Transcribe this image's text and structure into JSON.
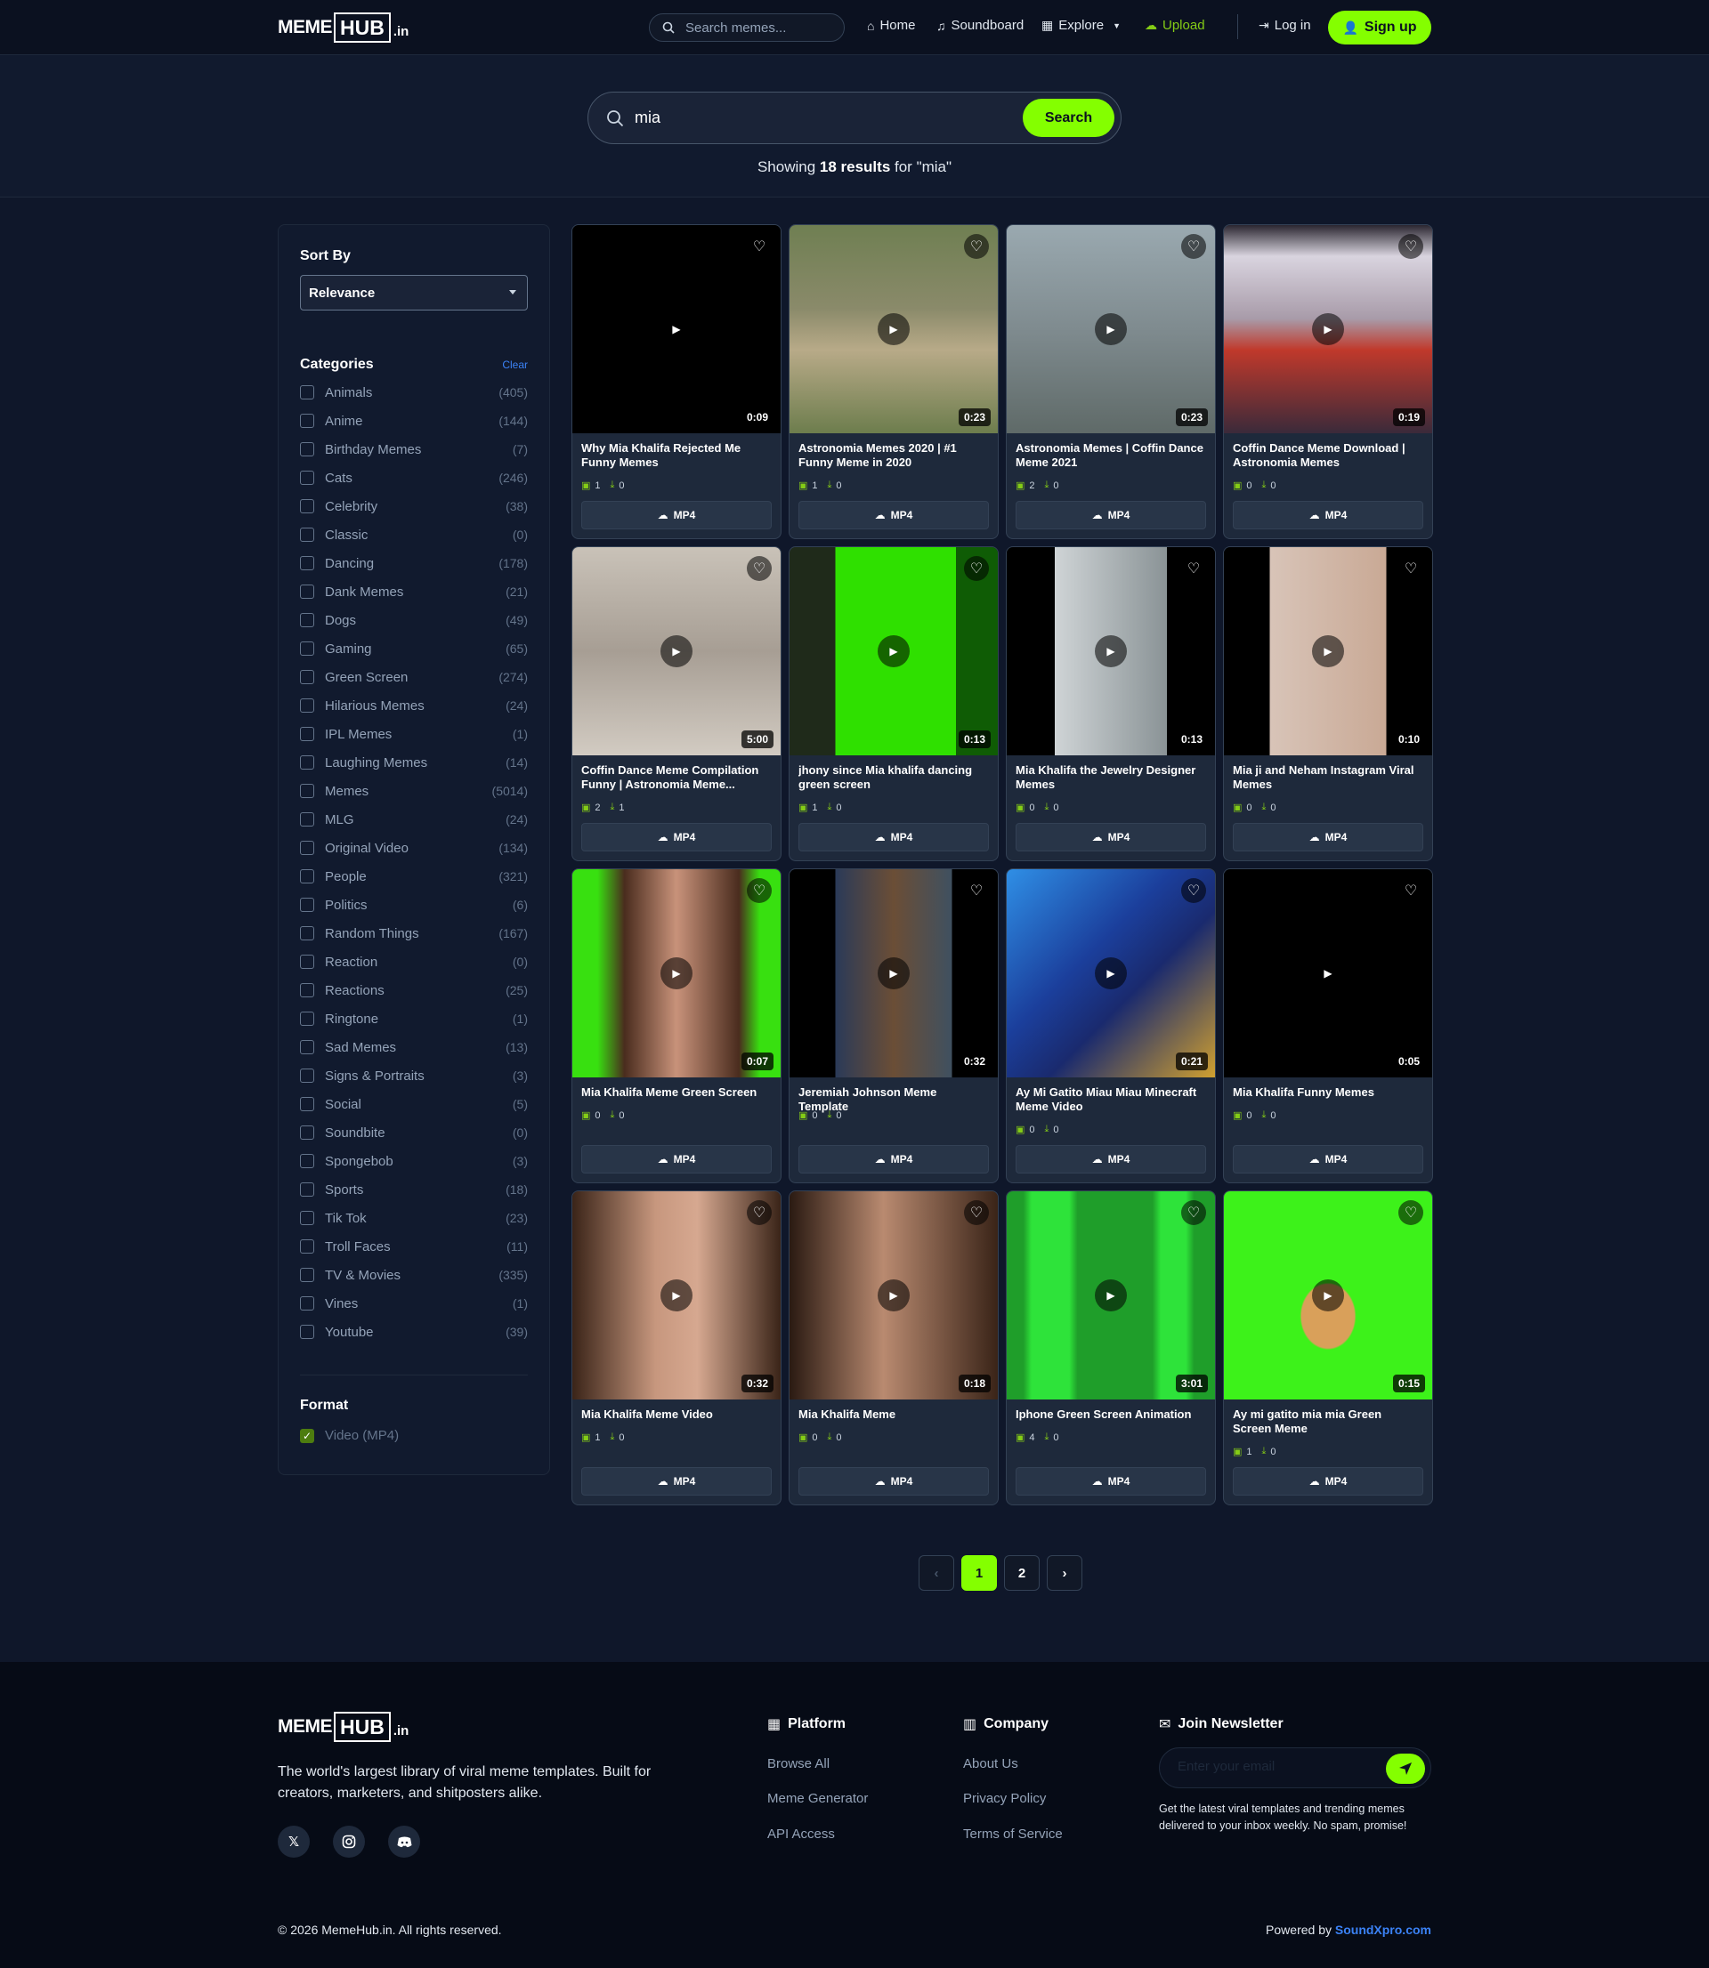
{
  "brand": {
    "meme": "MEME",
    "hub": "HUB",
    "tld": ".in"
  },
  "nav": {
    "search_placeholder": "Search memes...",
    "home": "Home",
    "soundboard": "Soundboard",
    "explore": "Explore",
    "upload": "Upload",
    "login": "Log in",
    "signup": "Sign up"
  },
  "hero": {
    "query": "mia",
    "search_button": "Search",
    "results_prefix": "Showing ",
    "results_count": "18 results",
    "results_suffix": " for \"mia\""
  },
  "sidebar": {
    "sort_title": "Sort By",
    "sort_value": "Relevance",
    "categories_title": "Categories",
    "clear": "Clear",
    "categories": [
      {
        "name": "Animals",
        "count": "(405)"
      },
      {
        "name": "Anime",
        "count": "(144)"
      },
      {
        "name": "Birthday Memes",
        "count": "(7)"
      },
      {
        "name": "Cats",
        "count": "(246)"
      },
      {
        "name": "Celebrity",
        "count": "(38)"
      },
      {
        "name": "Classic",
        "count": "(0)"
      },
      {
        "name": "Dancing",
        "count": "(178)"
      },
      {
        "name": "Dank Memes",
        "count": "(21)"
      },
      {
        "name": "Dogs",
        "count": "(49)"
      },
      {
        "name": "Gaming",
        "count": "(65)"
      },
      {
        "name": "Green Screen",
        "count": "(274)"
      },
      {
        "name": "Hilarious Memes",
        "count": "(24)"
      },
      {
        "name": "IPL Memes",
        "count": "(1)"
      },
      {
        "name": "Laughing Memes",
        "count": "(14)"
      },
      {
        "name": "Memes",
        "count": "(5014)"
      },
      {
        "name": "MLG",
        "count": "(24)"
      },
      {
        "name": "Original Video",
        "count": "(134)"
      },
      {
        "name": "People",
        "count": "(321)"
      },
      {
        "name": "Politics",
        "count": "(6)"
      },
      {
        "name": "Random Things",
        "count": "(167)"
      },
      {
        "name": "Reaction",
        "count": "(0)"
      },
      {
        "name": "Reactions",
        "count": "(25)"
      },
      {
        "name": "Ringtone",
        "count": "(1)"
      },
      {
        "name": "Sad Memes",
        "count": "(13)"
      },
      {
        "name": "Signs & Portraits",
        "count": "(3)"
      },
      {
        "name": "Social",
        "count": "(5)"
      },
      {
        "name": "Soundbite",
        "count": "(0)"
      },
      {
        "name": "Spongebob",
        "count": "(3)"
      },
      {
        "name": "Sports",
        "count": "(18)"
      },
      {
        "name": "Tik Tok",
        "count": "(23)"
      },
      {
        "name": "Troll Faces",
        "count": "(11)"
      },
      {
        "name": "TV & Movies",
        "count": "(335)"
      },
      {
        "name": "Vines",
        "count": "(1)"
      },
      {
        "name": "Youtube",
        "count": "(39)"
      }
    ],
    "format_title": "Format",
    "format_option": "Video (MP4)"
  },
  "cards": [
    {
      "title": "Why Mia Khalifa Rejected Me Funny Memes",
      "duration": "0:09",
      "a": "1",
      "b": "0",
      "bg": "#000000",
      "fav_dark": false
    },
    {
      "title": "Astronomia Memes 2020 | #1 Funny Meme in 2020",
      "duration": "0:23",
      "a": "1",
      "b": "0",
      "bg": "linear-gradient(180deg,#6f7f52 0%,#8a8a6a 40%,#b8aa88 60%,#6d7d4d 100%)",
      "fav_dark": true
    },
    {
      "title": "Astronomia Memes | Coffin Dance Meme 2021",
      "duration": "0:23",
      "a": "2",
      "b": "0",
      "bg": "linear-gradient(180deg,#9aa9b0 0%,#7f8b8f 50%,#5f6a68 100%)",
      "fav_dark": true
    },
    {
      "title": "Coffin Dance Meme Download | Astronomia Memes",
      "duration": "0:19",
      "a": "0",
      "b": "0",
      "bg": "linear-gradient(180deg,#2a2630 0%,#d9d4df 15%,#a89ba9 45%,#c0392b 60%,#3b2a3a 100%)",
      "fav_dark": true
    },
    {
      "title": "Coffin Dance Meme Compilation Funny | Astronomia Meme...",
      "duration": "5:00",
      "a": "2",
      "b": "1",
      "bg": "linear-gradient(180deg,#c9c2b8 0%,#a79e94 50%,#d2cbc2 100%)",
      "fav_dark": true
    },
    {
      "title": "jhony since Mia khalifa dancing green screen",
      "duration": "0:13",
      "a": "1",
      "b": "0",
      "bg": "linear-gradient(90deg,#1f2a1a 0%,#1f2a1a 22%,#2fe000 22%,#2fe000 80%,#0f5c05 80%)",
      "fav_dark": true
    },
    {
      "title": "Mia Khalifa the Jewelry Designer Memes",
      "duration": "0:13",
      "a": "0",
      "b": "0",
      "bg": "linear-gradient(90deg,#000 0%,#000 23%,#cfd4d6 23%,#8a9396 77%,#000 77%)",
      "fav_dark": false
    },
    {
      "title": "Mia ji and Neham Instagram Viral Memes",
      "duration": "0:10",
      "a": "0",
      "b": "0",
      "bg": "linear-gradient(90deg,#000 0%,#000 22%,#d8c4b8 22%,#c9a995 78%,#000 78%)",
      "fav_dark": false
    },
    {
      "title": "Mia Khalifa Meme Green Screen",
      "duration": "0:07",
      "a": "0",
      "b": "0",
      "bg": "linear-gradient(90deg,#38e010 0%,#38e010 12%,#4a2c1e 25%,#c8927a 50%,#4a2c1e 80%,#38e010 90%)",
      "fav_dark": true
    },
    {
      "title": "Jeremiah Johnson Meme Template",
      "duration": "0:32",
      "a": "0",
      "b": "0",
      "bg": "linear-gradient(90deg,#000 0%,#000 22%,#2a3a58 22%,#6b4e36 50%,#3f5060 78%,#000 78%)",
      "fav_dark": false
    },
    {
      "title": "Ay Mi Gatito Miau Miau Minecraft Meme Video",
      "duration": "0:21",
      "a": "0",
      "b": "0",
      "bg": "linear-gradient(135deg,#2f8fe6 0%,#1b3f9c 40%,#1a2a6e 60%,#d0a030 100%)",
      "fav_dark": true
    },
    {
      "title": "Mia Khalifa Funny Memes",
      "duration": "0:05",
      "a": "0",
      "b": "0",
      "bg": "#000000",
      "fav_dark": false
    },
    {
      "title": "Mia Khalifa Meme Video",
      "duration": "0:32",
      "a": "1",
      "b": "0",
      "bg": "linear-gradient(90deg,#3a2418 0%,#c7977e 40%,#d6a890 60%,#3a2418 100%)",
      "fav_dark": true
    },
    {
      "title": "Mia Khalifa Meme",
      "duration": "0:18",
      "a": "0",
      "b": "0",
      "bg": "linear-gradient(90deg,#2a1a12 0%,#b98a70 45%,#3a2418 100%)",
      "fav_dark": true
    },
    {
      "title": "Iphone Green Screen Animation",
      "duration": "3:01",
      "a": "4",
      "b": "0",
      "bg": "linear-gradient(90deg,#1f9e2a 0%,#1f9e2a 8%,#2ee33a 12%,#2ee33a 30%,#1f9e2a 34%,#1f9e2a 70%,#2ee33a 74%,#2ee33a 86%,#1f9e2a 90%)",
      "fav_dark": true
    },
    {
      "title": "Ay mi gatito mia mia Green Screen Meme",
      "duration": "0:15",
      "a": "1",
      "b": "0",
      "bg": "radial-gradient(ellipse at 50% 60%,#d9a05a 0%,#d9a05a 18%,#3df21a 19%)",
      "fav_dark": true
    }
  ],
  "card_button": "MP4",
  "pagination": {
    "prev": "‹",
    "pages": [
      "1",
      "2"
    ],
    "next": "›",
    "active": "1"
  },
  "footer": {
    "description": "The world's largest library of viral meme templates. Built for creators, marketers, and shitposters alike.",
    "platform_title": "Platform",
    "platform_links": [
      "Browse All",
      "Meme Generator",
      "API Access"
    ],
    "company_title": "Company",
    "company_links": [
      "About Us",
      "Privacy Policy",
      "Terms of Service"
    ],
    "newsletter_title": "Join Newsletter",
    "newsletter_placeholder": "Enter your email",
    "newsletter_note": "Get the latest viral templates and trending memes delivered to your inbox weekly. No spam, promise!",
    "copyright": "© 2026 MemeHub.in. All rights reserved.",
    "powered_prefix": "Powered by ",
    "powered_link": "SoundXpro.com"
  },
  "colors": {
    "accent": "#84ff00",
    "bg": "#0f172a",
    "card": "#1e293b",
    "link": "#3b82f6"
  }
}
